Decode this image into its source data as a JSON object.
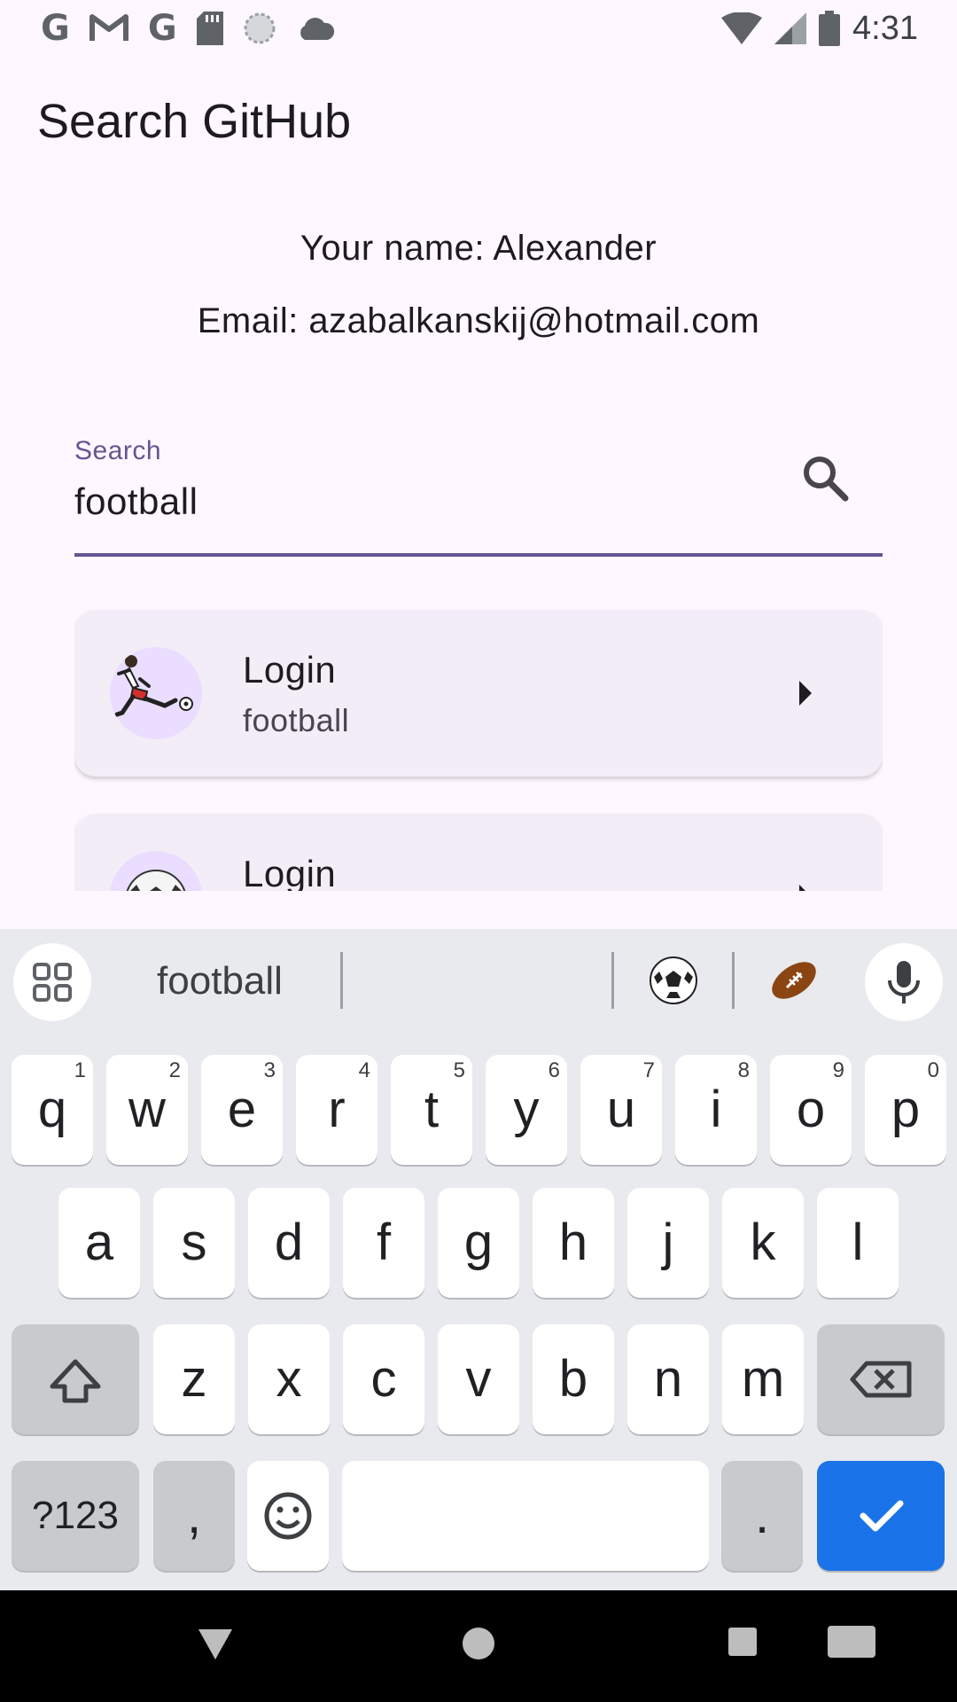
{
  "status_bar": {
    "time": "4:31",
    "left_icons": [
      "google-g-icon",
      "gmail-icon",
      "google-g-icon",
      "sd-card-icon",
      "sync-circle-icon",
      "cloud-icon"
    ],
    "right_icons": [
      "wifi-icon",
      "cell-signal-icon",
      "battery-icon"
    ]
  },
  "app_bar": {
    "title": "Search GitHub"
  },
  "profile": {
    "name_line": "Your name: Alexander",
    "email_line": "Email: azabalkanskij@hotmail.com"
  },
  "search": {
    "label": "Search",
    "value": "football",
    "accent_color": "#65558f"
  },
  "results": [
    {
      "title": "Login",
      "subtitle": "football",
      "avatar": "soccer-player-avatar"
    },
    {
      "title": "Login",
      "subtitle": "",
      "avatar": "soccer-ball-avatar"
    }
  ],
  "keyboard": {
    "suggestion": "football",
    "emoji_suggestions": [
      "⚽",
      "🏈"
    ],
    "row1": [
      {
        "k": "q",
        "h": "1"
      },
      {
        "k": "w",
        "h": "2"
      },
      {
        "k": "e",
        "h": "3"
      },
      {
        "k": "r",
        "h": "4"
      },
      {
        "k": "t",
        "h": "5"
      },
      {
        "k": "y",
        "h": "6"
      },
      {
        "k": "u",
        "h": "7"
      },
      {
        "k": "i",
        "h": "8"
      },
      {
        "k": "o",
        "h": "9"
      },
      {
        "k": "p",
        "h": "0"
      }
    ],
    "row2": [
      "a",
      "s",
      "d",
      "f",
      "g",
      "h",
      "j",
      "k",
      "l"
    ],
    "row3": [
      "z",
      "x",
      "c",
      "v",
      "b",
      "n",
      "m"
    ],
    "symbols_label": "?123",
    "comma": ",",
    "period": ".",
    "action_color": "#1a73e8"
  },
  "nav_bar": {
    "icons": [
      "back-icon",
      "home-icon",
      "recents-icon",
      "keyboard-switch-icon"
    ]
  }
}
